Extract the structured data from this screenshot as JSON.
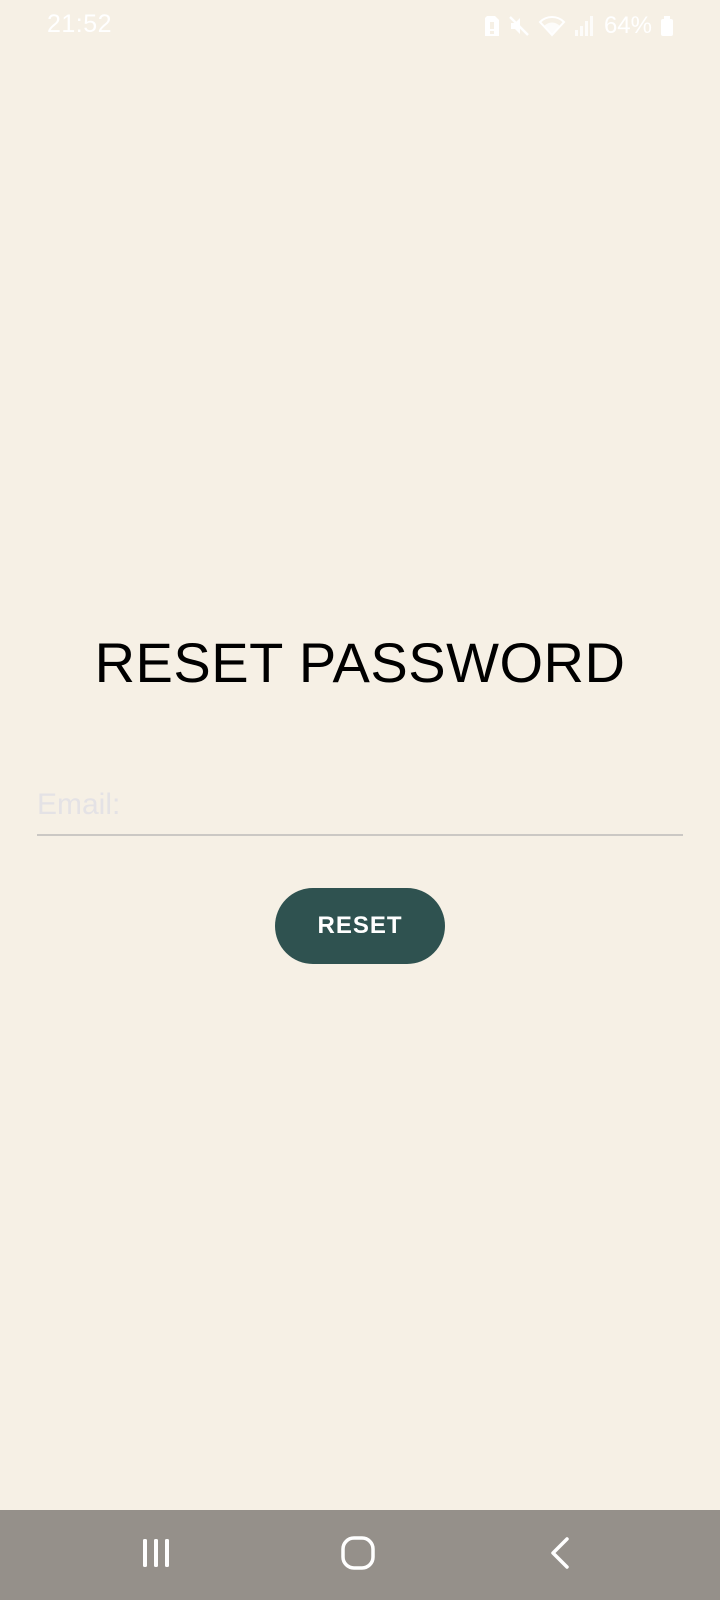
{
  "status_bar": {
    "time": "21:52",
    "battery": "64%",
    "icons": [
      "sim-alert-icon",
      "mute-icon",
      "wifi-icon",
      "signal-icon",
      "battery-icon"
    ]
  },
  "page": {
    "title": "RESET PASSWORD"
  },
  "form": {
    "email_placeholder": "Email:",
    "email_value": "",
    "reset_label": "RESET"
  },
  "nav_bar": {
    "icons": [
      "recents-icon",
      "home-icon",
      "back-icon"
    ]
  },
  "colors": {
    "background": "#F6F0E5",
    "button": "#2F5250",
    "button_text": "#FFFFFF",
    "nav_bar": "#95908A",
    "underline": "#CBC8C4",
    "placeholder": "#E4E2E5"
  }
}
